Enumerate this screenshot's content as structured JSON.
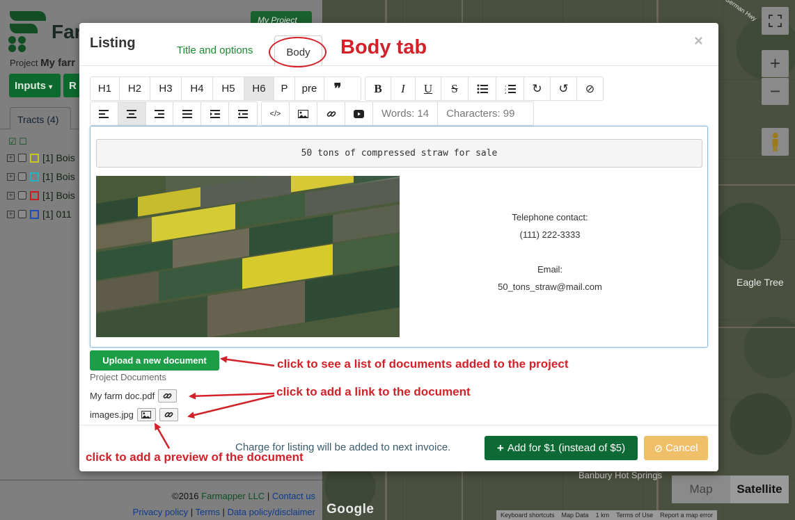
{
  "app": {
    "brand": "Far",
    "project_prefix": "Project",
    "project_name": "My farr",
    "my_projects_label": "My Project",
    "inputs_label": "Inputs",
    "inputs_partial_btn": "R",
    "tracts_tab": "Tracts (4)",
    "tracts": [
      {
        "label": "[1] Bois",
        "color": "#c8c81e"
      },
      {
        "label": "[1] Bois",
        "color": "#1eb4c8"
      },
      {
        "label": "[1] Bois",
        "color": "#c81e1e"
      },
      {
        "label": "[1] 011",
        "color": "#1e4bb4"
      }
    ],
    "footer": {
      "copyright": "©2016",
      "company": "Farmapper LLC",
      "sep": "|",
      "contact": "Contact us",
      "privacy": "Privacy policy",
      "terms": "Terms",
      "data_policy": "Data policy/disclaimer"
    }
  },
  "map": {
    "label_eagle": "Eagle Tree",
    "label_banbury": "Banbury Hot Springs",
    "label_road": "German Hwy",
    "google": "Google",
    "type_map": "Map",
    "type_satellite": "Satellite",
    "zoom_in": "+",
    "zoom_out": "−",
    "attribution": [
      "Keyboard shortcuts",
      "Map Data",
      "1 km",
      "Terms of Use",
      "Report a map error"
    ]
  },
  "modal": {
    "title": "Listing",
    "tab_title_options": "Title and options",
    "tab_body": "Body",
    "close": "×",
    "toolbar_row1": [
      "H1",
      "H2",
      "H3",
      "H4",
      "H5",
      "H6",
      "P",
      "pre"
    ],
    "active_heading": "H6",
    "words": "Words: 14",
    "characters": "Characters: 99",
    "editor": {
      "code_line": "50 tons of compressed straw for sale",
      "phone_label": "Telephone contact:",
      "phone": "(111) 222-3333",
      "email_label": "Email:",
      "email": "50_tons_straw@mail.com"
    },
    "upload_button": "Upload a new document",
    "documents_heading": "Project Documents",
    "documents": [
      "My farm doc.pdf",
      "images.jpg"
    ],
    "charge_note": "Charge for listing will be added to next invoice.",
    "add_button": "Add for $1 (instead of $5)",
    "cancel_button": "Cancel"
  },
  "annotations": {
    "body_tab": "Body tab",
    "upload": "click to see a list of documents added to the project",
    "link": "click to add a link to the document",
    "preview": "click to add a preview of the document",
    "color": "#d3212a"
  }
}
